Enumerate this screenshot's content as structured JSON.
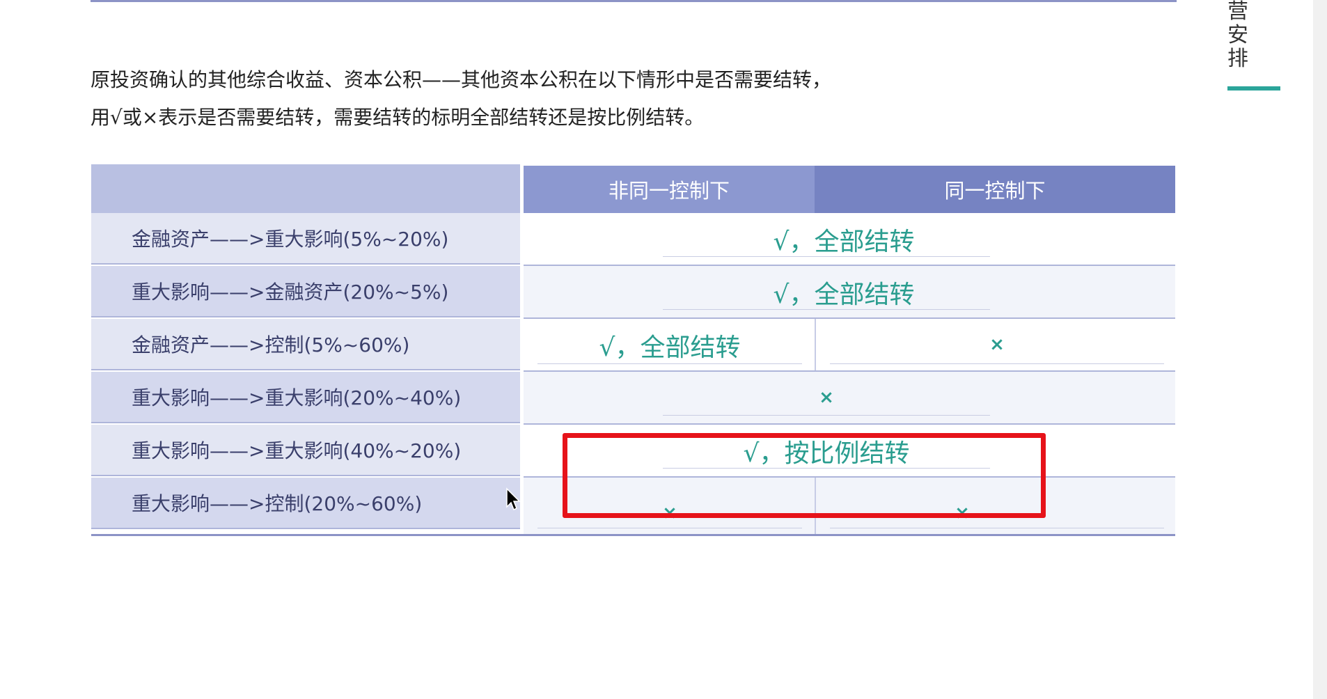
{
  "side_label": [
    "营",
    "安",
    "排"
  ],
  "intro": {
    "line1": "原投资确认的其他综合收益、资本公积——其他资本公积在以下情形中是否需要结转，",
    "line2": "用√或×表示是否需要结转，需要结转的标明全部结转还是按比例结转。"
  },
  "table": {
    "headers": [
      "",
      "非同一控制下",
      "同一控制下"
    ],
    "rows": [
      {
        "label": "金融资产——>重大影响(5%~20%)",
        "merged": "√，全部结转"
      },
      {
        "label": "重大影响——>金融资产(20%~5%)",
        "merged": "√，全部结转"
      },
      {
        "label": "金融资产——>控制(5%~60%)",
        "col1": "√，全部结转",
        "col2": "×"
      },
      {
        "label": "重大影响——>重大影响(20%~40%)",
        "merged": "×"
      },
      {
        "label": "重大影响——>重大影响(40%~20%)",
        "merged": "√，按比例结转"
      },
      {
        "label": "重大影响——>控制(20%~60%)",
        "col1": "×",
        "col2": "×"
      }
    ]
  },
  "colors": {
    "header_light": "#8c98d0",
    "header_dark": "#7683c2",
    "handwriting": "#2a9d8f",
    "highlight": "#e6131a",
    "accent_rule": "#2ba59a"
  }
}
